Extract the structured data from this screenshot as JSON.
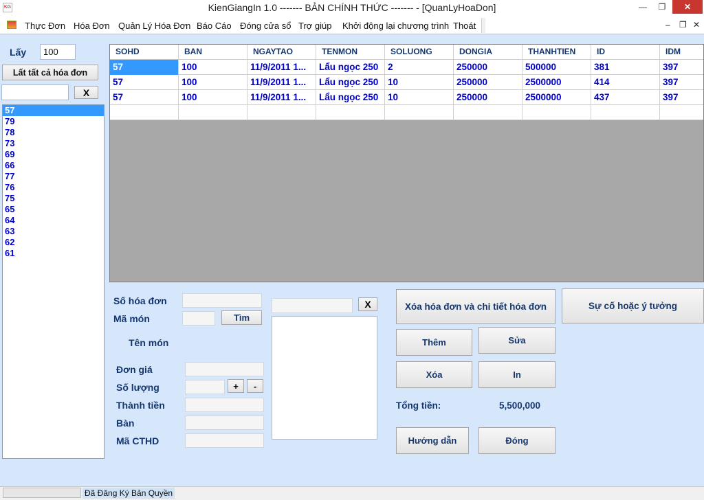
{
  "window": {
    "title": "KienGiangIn 1.0 ------- BẢN CHÍNH THỨC -------  - [QuanLyHoaDon]",
    "minimize": "—",
    "maximize": "❐",
    "close": "✕",
    "app_icon_text": "KG"
  },
  "menu": {
    "items": [
      "Thực Đơn",
      "Hóa Đơn",
      "Quản Lý Hóa Đơn",
      "Báo Cáo",
      "Đóng cửa sổ",
      "Trợ giúp",
      "Khởi động lại chương trình",
      "Thoát"
    ],
    "mdi_minimize": "–",
    "mdi_restore": "❐",
    "mdi_close": "✕"
  },
  "left": {
    "lay_label": "Lấy",
    "lay_value": "100",
    "show_all_button": "Lất tất cả hóa đơn",
    "search_value": "",
    "clear_button": "X",
    "invoices": [
      "57",
      "79",
      "78",
      "73",
      "69",
      "66",
      "77",
      "76",
      "75",
      "65",
      "64",
      "63",
      "62",
      "61"
    ],
    "selected": "57"
  },
  "grid": {
    "columns": [
      "SOHD",
      "BAN",
      "NGAYTAO",
      "TENMON",
      "SOLUONG",
      "DONGIA",
      "THANHTIEN",
      "ID",
      "IDM"
    ],
    "rows": [
      [
        "57",
        "100",
        "11/9/2011 1...",
        "Lẩu ngọc 250",
        "2",
        "250000",
        "500000",
        "381",
        "397"
      ],
      [
        "57",
        "100",
        "11/9/2011 1...",
        "Lẩu ngọc 250",
        "10",
        "250000",
        "2500000",
        "414",
        "397"
      ],
      [
        "57",
        "100",
        "11/9/2011 1...",
        "Lẩu ngọc 250",
        "10",
        "250000",
        "2500000",
        "437",
        "397"
      ]
    ]
  },
  "form": {
    "so_hoa_don_label": "Số hóa đơn",
    "ma_mon_label": "Mã món",
    "tim_button": "Tìm",
    "ten_mon_label": "Tên món",
    "don_gia_label": "Đơn giá",
    "so_luong_label": "Số lượng",
    "plus_button": "+",
    "minus_button": "-",
    "thanh_tien_label": "Thành tiền",
    "ban_label": "Bàn",
    "ma_cthd_label": "Mã CTHD",
    "food_search_value": "",
    "food_clear_button": "X"
  },
  "actions": {
    "delete_invoice_button": "Xóa hóa đơn và chi tiết hóa đơn",
    "report_issue_button": "Sự cố hoặc ý tưởng",
    "them_button": "Thêm",
    "sua_button": "Sửa",
    "xoa_button": "Xóa",
    "in_button": "In",
    "tong_tien_label": "Tổng tiền:",
    "tong_tien_value": "5,500,000",
    "huong_dan_button": "Hướng dẫn",
    "dong_button": "Đóng"
  },
  "status": {
    "text": "Đã Đăng Ký Bản Quyền"
  }
}
